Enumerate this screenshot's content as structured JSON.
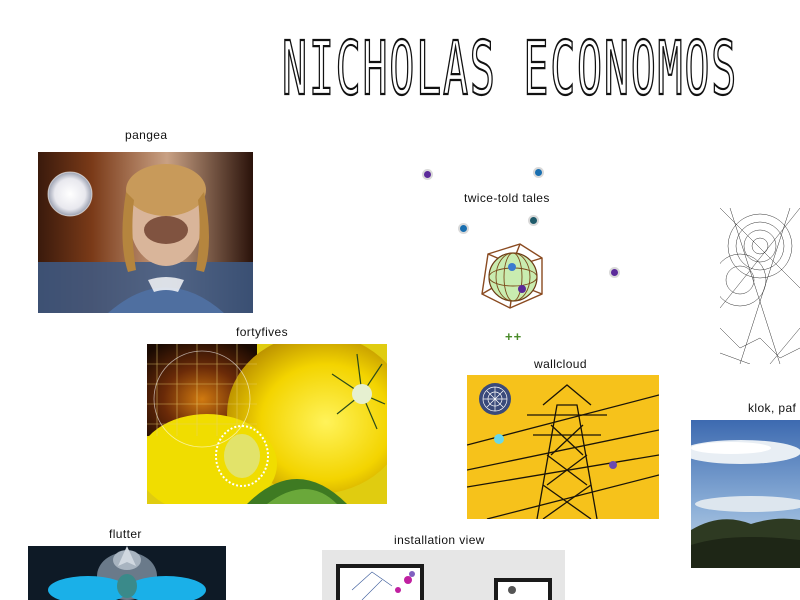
{
  "site": {
    "title": "NICHOLAS ECONOMOS"
  },
  "projects": {
    "pangea": {
      "label": "pangea"
    },
    "fortyfives": {
      "label": "fortyfives"
    },
    "twice_told_tales": {
      "label": "twice-told tales",
      "more": "++"
    },
    "wallcloud": {
      "label": "wallcloud"
    },
    "klok": {
      "label": "klok, paf"
    },
    "flutter": {
      "label": "flutter"
    },
    "installation": {
      "label": "installation view"
    }
  },
  "colors": {
    "accent_green": "#4a8b2a",
    "wallcloud_yellow": "#f6c21b",
    "dot_blue": "#1a6fb0",
    "dot_purple": "#5b2a9a"
  }
}
